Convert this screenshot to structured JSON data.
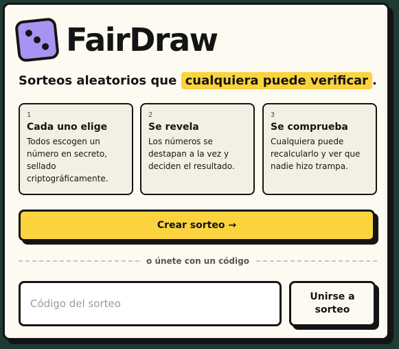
{
  "brand": {
    "name": "FairDraw",
    "logo_icon": "dice-icon"
  },
  "tagline": {
    "before": "Sorteos aleatorios que ",
    "highlight": "cualquiera puede verificar",
    "after": "."
  },
  "steps": [
    {
      "num": "1",
      "title": "Cada uno elige",
      "desc": "Todos escogen un número en secreto, sellado criptográficamente."
    },
    {
      "num": "2",
      "title": "Se revela",
      "desc": "Los números se destapan a la vez y deciden el resultado."
    },
    {
      "num": "3",
      "title": "Se comprueba",
      "desc": "Cualquiera puede recalcularlo y ver que nadie hizo trampa."
    }
  ],
  "create_button": {
    "label": "Crear sorteo →"
  },
  "divider": {
    "label": "o únete con un código"
  },
  "join": {
    "placeholder": "Código del sorteo",
    "value": "",
    "button_label": "Unirse a sorteo"
  },
  "colors": {
    "accent": "#fbd33e",
    "dice": "#a893f2",
    "ink": "#141414",
    "card": "#fdfaf2",
    "background": "#1e3b34"
  }
}
